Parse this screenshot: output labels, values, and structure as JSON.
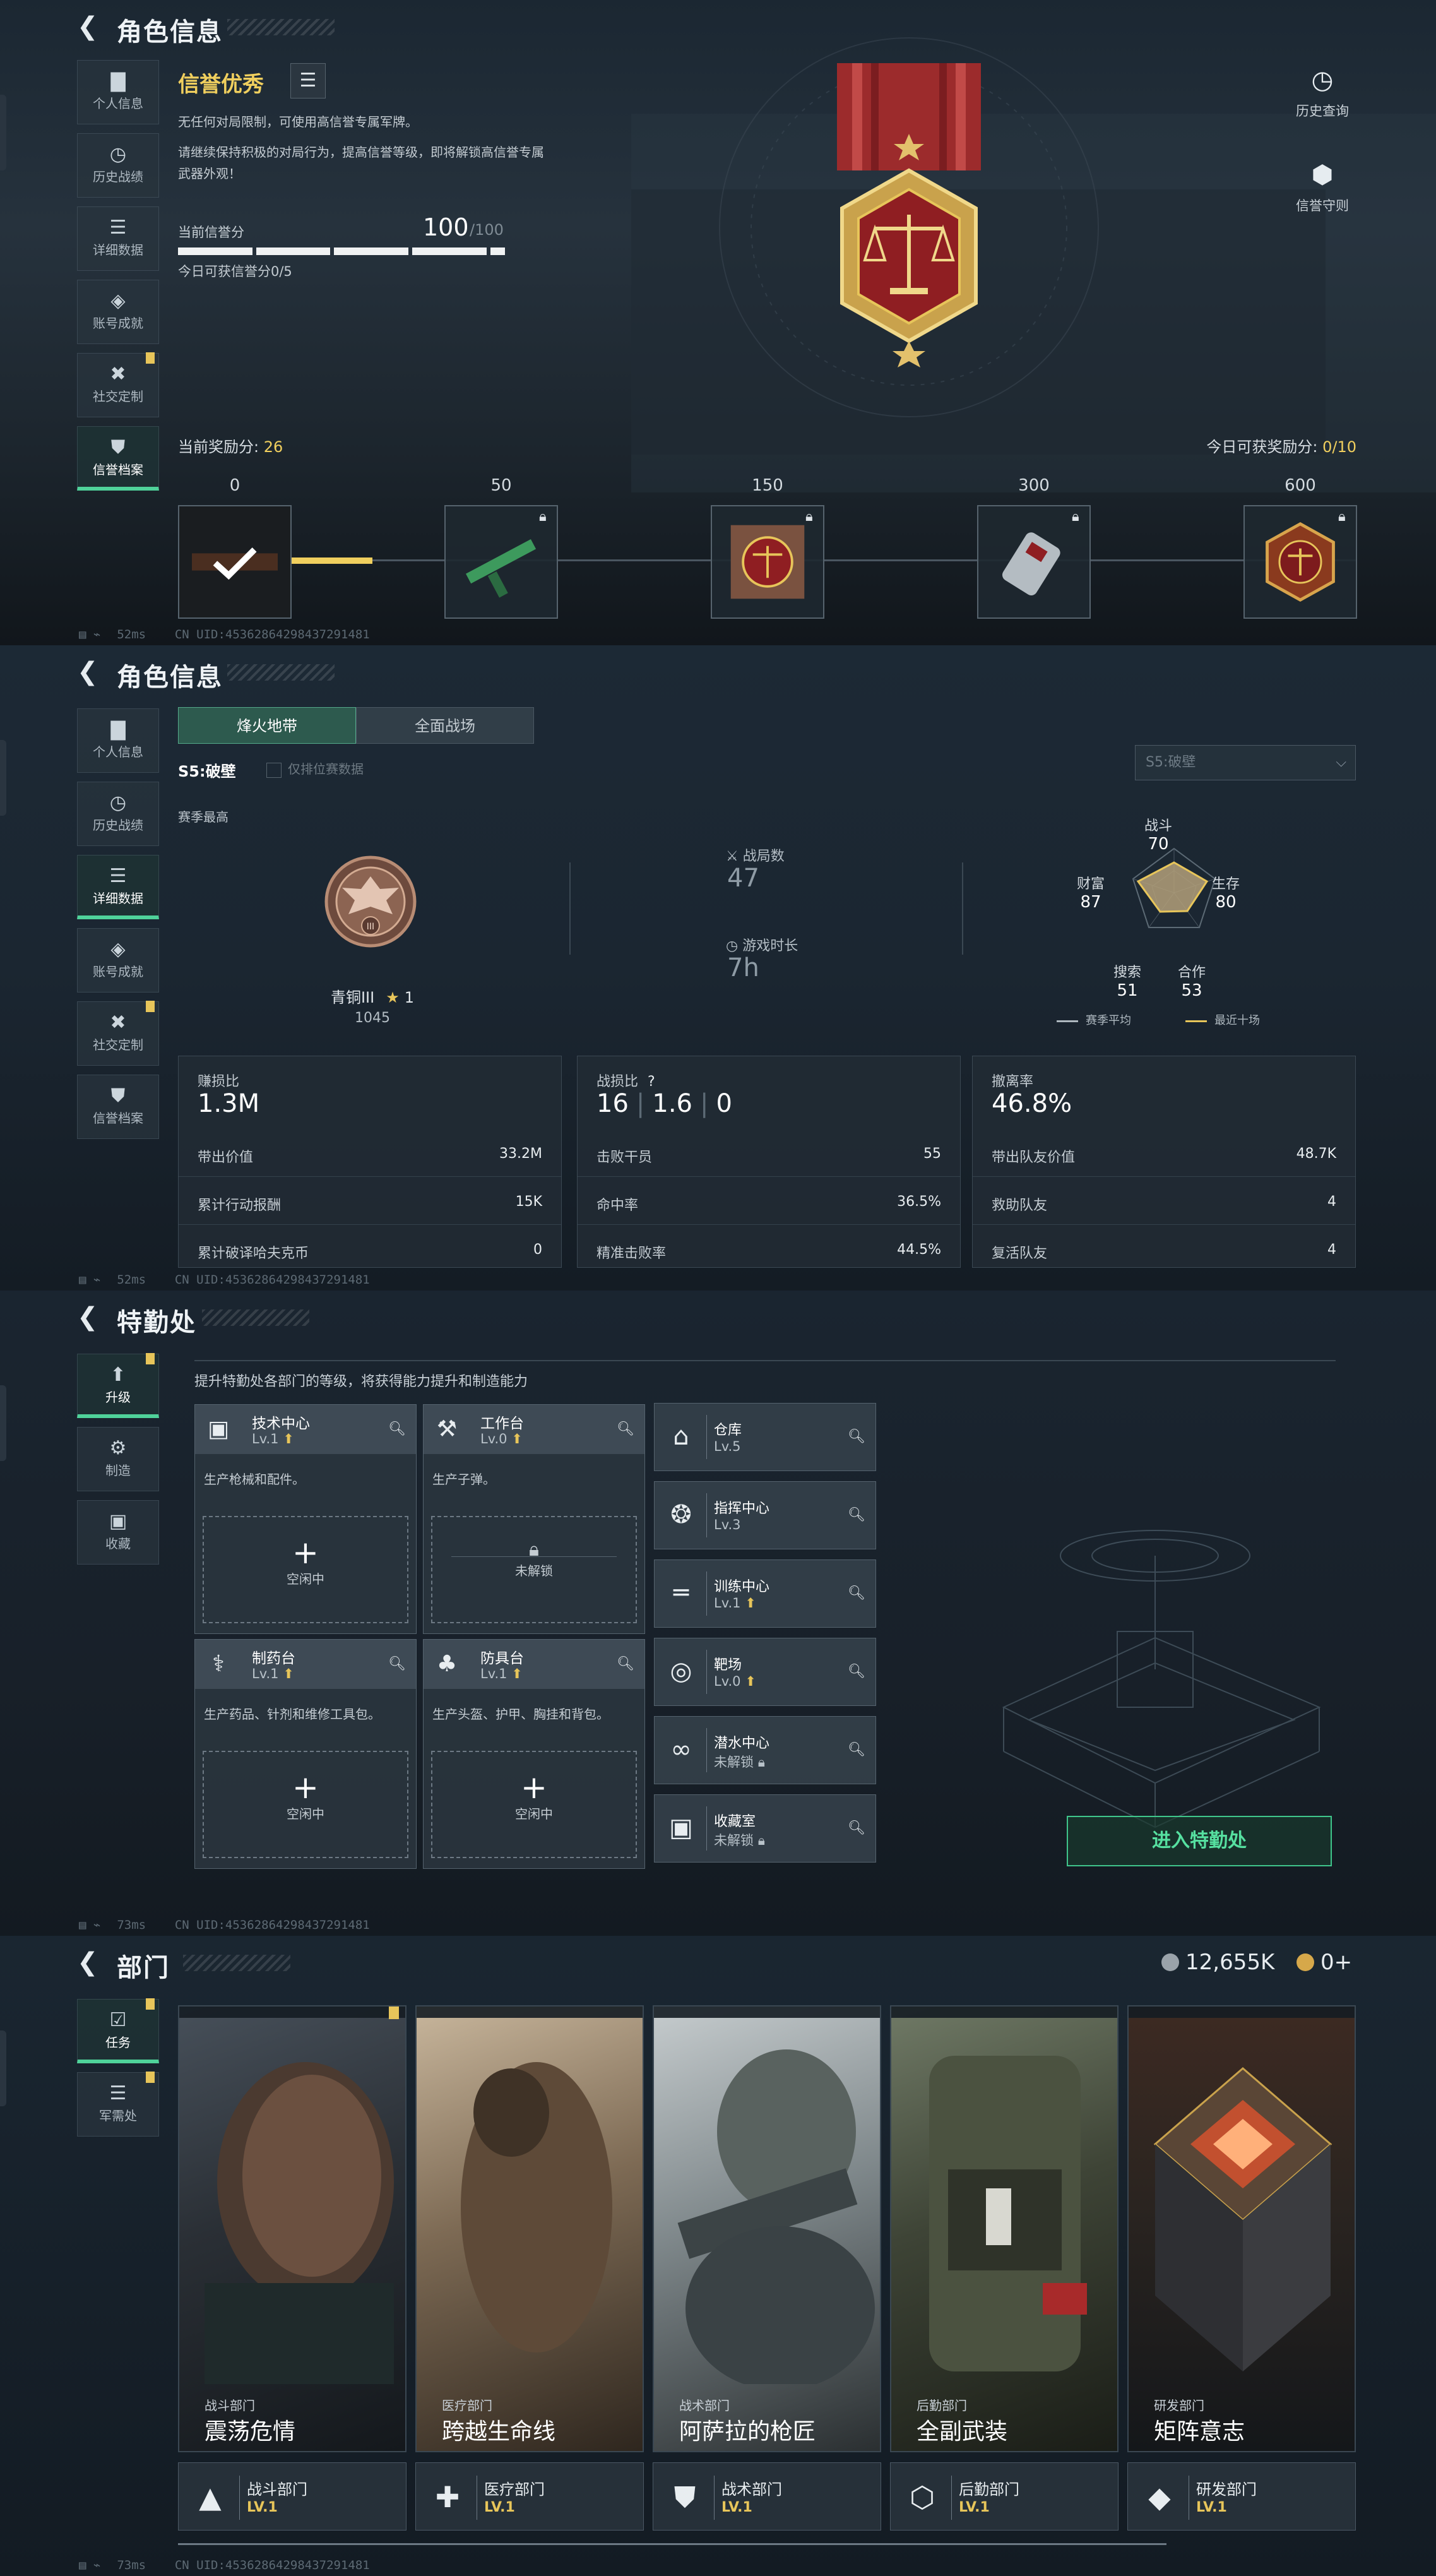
{
  "colors": {
    "accent_green": "#4fd29a",
    "gold": "#f0cf5e",
    "panel": "#1c2935"
  },
  "footer": {
    "ping1": "52ms",
    "ping2": "52ms",
    "ping3": "73ms",
    "ping4": "73ms",
    "uid": "CN UID:4536286429843729148​1"
  },
  "p1": {
    "title": "角色信息",
    "nav": [
      {
        "label": "个人信息",
        "icon": "bar-chart-icon"
      },
      {
        "label": "历史战绩",
        "icon": "clock-icon"
      },
      {
        "label": "详细数据",
        "icon": "cards-icon"
      },
      {
        "label": "账号成就",
        "icon": "achievement-icon"
      },
      {
        "label": "社交定制",
        "icon": "tools-icon"
      },
      {
        "label": "信誉档案",
        "icon": "shield-icon"
      }
    ],
    "honor_title": "信誉优秀",
    "desc1": "无任何对局限制，可使用高信誉专属军牌。",
    "desc2": "请继续保持积极的对局行为，提高信誉等级，即将解锁高信誉专属",
    "desc3": "武器外观！",
    "score_label": "当前信誉分",
    "score_value": "100",
    "score_max": "/100",
    "score_today": "今日可获信誉分0/5",
    "reward_left_label": "当前奖励分:",
    "reward_left_value": "26",
    "reward_right_label": "今日可获奖励分:",
    "reward_right_value": "0/10",
    "milestones": [
      "0",
      "50",
      "150",
      "300",
      "600"
    ],
    "history_btn": "历史查询",
    "rules_btn": "信誉守则"
  },
  "p2": {
    "title": "角色信息",
    "nav": [
      {
        "label": "个人信息"
      },
      {
        "label": "历史战绩"
      },
      {
        "label": "详细数据"
      },
      {
        "label": "账号成就"
      },
      {
        "label": "社交定制"
      },
      {
        "label": "信誉档案"
      }
    ],
    "tabs": [
      "烽火地带",
      "全面战场"
    ],
    "season_label": "S5:破壁",
    "ranked_only": "仅排位赛数据",
    "season_select": "S5:破壁",
    "season_high": "赛季最高",
    "rank_name": "青铜III",
    "rank_stars": "1",
    "rank_points": "1045",
    "matches_label": "战局数",
    "matches_value": "47",
    "playtime_label": "游戏时长",
    "playtime_value": "7h",
    "radar": {
      "combat_label": "战斗",
      "combat": "70",
      "survive_label": "生存",
      "survive": "80",
      "coop_label": "合作",
      "coop": "53",
      "search_label": "搜索",
      "search": "51",
      "wealth_label": "财富",
      "wealth": "87"
    },
    "legend_season": "赛季平均",
    "legend_recent": "最近十场",
    "card1": {
      "title": "赚损比",
      "big": "1.3M",
      "rows": [
        [
          "带出价值",
          "33.2M"
        ],
        [
          "累计行动报酬",
          "15K"
        ],
        [
          "累计破译哈夫克币",
          "0"
        ]
      ]
    },
    "card2": {
      "title": "战损比",
      "q": "?",
      "k1": "16",
      "k2": "1.6",
      "k3": "0",
      "rows": [
        [
          "击败干员",
          "55"
        ],
        [
          "命中率",
          "36.5%"
        ],
        [
          "精准击败率",
          "44.5%"
        ]
      ]
    },
    "card3": {
      "title": "撤离率",
      "big": "46.8%",
      "rows": [
        [
          "带出队友价值",
          "48.7K"
        ],
        [
          "救助队友",
          "4"
        ],
        [
          "复活队友",
          "4"
        ]
      ]
    }
  },
  "p3": {
    "title": "特勤处",
    "nav": [
      {
        "label": "升级"
      },
      {
        "label": "制造"
      },
      {
        "label": "收藏"
      }
    ],
    "hint": "提升特勤处各部门的等级，将获得能力提升和制造能力",
    "cards": [
      {
        "name": "技术中心",
        "lv": "Lv.1",
        "desc": "生产枪械和配件。",
        "slot": "空闲中"
      },
      {
        "name": "工作台",
        "lv": "Lv.0",
        "desc": "生产子弹。",
        "slot": "未解锁"
      },
      {
        "name": "制药台",
        "lv": "Lv.1",
        "desc": "生产药品、针剂和维修工具包。",
        "slot": "空闲中"
      },
      {
        "name": "防具台",
        "lv": "Lv.1",
        "desc": "生产头盔、护甲、胸挂和背包。",
        "slot": "空闲中"
      }
    ],
    "facilities": [
      {
        "name": "仓库",
        "lv": "Lv.5"
      },
      {
        "name": "指挥中心",
        "lv": "Lv.3"
      },
      {
        "name": "训练中心",
        "lv": "Lv.1"
      },
      {
        "name": "靶场",
        "lv": "Lv.0"
      },
      {
        "name": "潜水中心",
        "lv": "未解锁"
      },
      {
        "name": "收藏室",
        "lv": "未解锁"
      }
    ],
    "enter": "进入特勤处"
  },
  "p4": {
    "title": "部门",
    "nav": [
      {
        "label": "任务"
      },
      {
        "label": "军需处"
      }
    ],
    "currency1": "12,655K",
    "currency2": "0+",
    "operations": [
      {
        "cat": "战斗部门",
        "title": "震荡危情"
      },
      {
        "cat": "医疗部门",
        "title": "跨越生命线"
      },
      {
        "cat": "战术部门",
        "title": "阿萨拉的枪匠"
      },
      {
        "cat": "后勤部门",
        "title": "全副武装"
      },
      {
        "cat": "研发部门",
        "title": "矩阵意志"
      }
    ],
    "departments": [
      {
        "name": "战斗部门",
        "lv": "LV.1"
      },
      {
        "name": "医疗部门",
        "lv": "LV.1"
      },
      {
        "name": "战术部门",
        "lv": "LV.1"
      },
      {
        "name": "后勤部门",
        "lv": "LV.1"
      },
      {
        "name": "研发部门",
        "lv": "LV.1"
      }
    ]
  }
}
